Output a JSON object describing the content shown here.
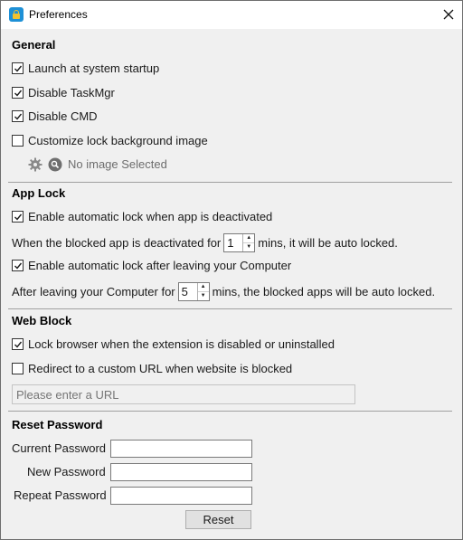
{
  "window": {
    "title": "Preferences"
  },
  "general": {
    "title": "General",
    "launch_startup": {
      "label": "Launch at system startup",
      "checked": true
    },
    "disable_taskmgr": {
      "label": "Disable TaskMgr",
      "checked": true
    },
    "disable_cmd": {
      "label": "Disable CMD",
      "checked": true
    },
    "custom_bg": {
      "label": "Customize lock background image",
      "checked": false
    },
    "no_image_text": "No image Selected"
  },
  "app_lock": {
    "title": "App Lock",
    "auto_lock_deactivated": {
      "label": "Enable automatic lock when app is deactivated",
      "checked": true
    },
    "deactivated_prefix": "When the blocked app is deactivated for",
    "deactivated_value": "1",
    "deactivated_suffix": "mins, it will be auto locked.",
    "auto_lock_leaving": {
      "label": "Enable automatic lock after leaving your Computer",
      "checked": true
    },
    "leaving_prefix": "After leaving your Computer for",
    "leaving_value": "5",
    "leaving_suffix": "mins, the blocked apps will be auto locked."
  },
  "web_block": {
    "title": "Web Block",
    "lock_browser": {
      "label": "Lock browser when the extension is disabled or uninstalled",
      "checked": true
    },
    "redirect_url": {
      "label": "Redirect to a custom URL when website is blocked",
      "checked": false
    },
    "url_placeholder": "Please enter a URL"
  },
  "reset_password": {
    "title": "Reset Password",
    "current_label": "Current Password",
    "new_label": "New Password",
    "repeat_label": "Repeat Password",
    "current_value": "",
    "new_value": "",
    "repeat_value": "",
    "reset_button": "Reset"
  },
  "colors": {
    "accent": "#1e90d6",
    "check": "#1a1a1a",
    "window_bg": "#f0f0f0"
  },
  "icons": [
    "app-lock-icon",
    "close-icon",
    "gear-icon",
    "search-icon",
    "checkmark-icon"
  ]
}
